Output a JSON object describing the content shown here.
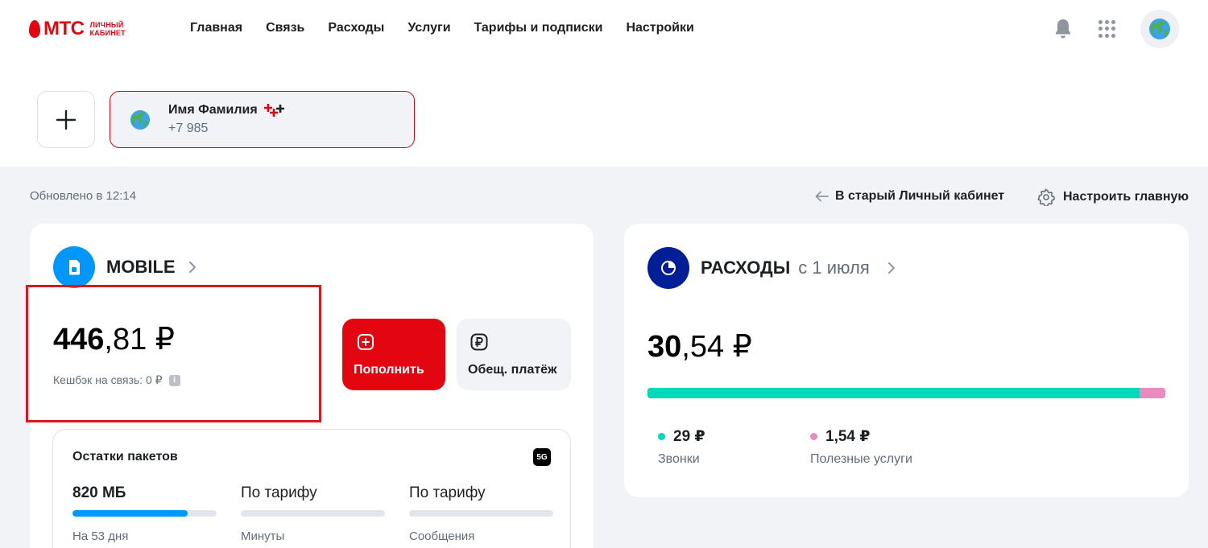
{
  "brand": {
    "logo_text": "МТС",
    "logo_sub_line1": "ЛИЧНЫЙ",
    "logo_sub_line2": "КАБИНЕТ",
    "accent": "#e30611"
  },
  "nav": {
    "items": [
      {
        "label": "Главная"
      },
      {
        "label": "Связь"
      },
      {
        "label": "Расходы"
      },
      {
        "label": "Услуги"
      },
      {
        "label": "Тарифы и подписки"
      },
      {
        "label": "Настройки"
      }
    ],
    "icons": [
      "bell-icon",
      "apps-grid-icon",
      "globe-avatar-icon"
    ]
  },
  "account": {
    "name": "Имя Фамилия",
    "phone": "+7 985",
    "add_icon": "plus-icon"
  },
  "toolbar": {
    "updated": "Обновлено в 12:14",
    "old_cabinet": "В старый Личный кабинет",
    "customize": "Настроить главную"
  },
  "mobile": {
    "title": "MOBILE",
    "balance_int": "446",
    "balance_frac": ",81 ₽",
    "cashback": "Кешбэк на связь: 0 ₽",
    "info_glyph": "i",
    "pay_label": "Пополнить",
    "promise_label": "Обещ. платёж",
    "packets": {
      "title": "Остатки пакетов",
      "badge": "5G",
      "items": [
        {
          "value": "820 МБ",
          "sub": "На 53 дня",
          "fill": 0.8
        },
        {
          "value": "По тарифу",
          "sub": "Минуты",
          "fill": 0
        },
        {
          "value": "По тарифу",
          "sub": "Сообщения",
          "fill": 0
        }
      ]
    }
  },
  "expenses": {
    "title": "РАСХОДЫ",
    "period": "с 1 июля",
    "amount_int": "30",
    "amount_frac": ",54 ₽",
    "segments": [
      {
        "value": "29 ₽",
        "label": "Звонки",
        "amount": 29,
        "color": "#00d9bc"
      },
      {
        "value": "1,54 ₽",
        "label": "Полезные услуги",
        "amount": 1.54,
        "color": "#e98bc1"
      }
    ]
  }
}
